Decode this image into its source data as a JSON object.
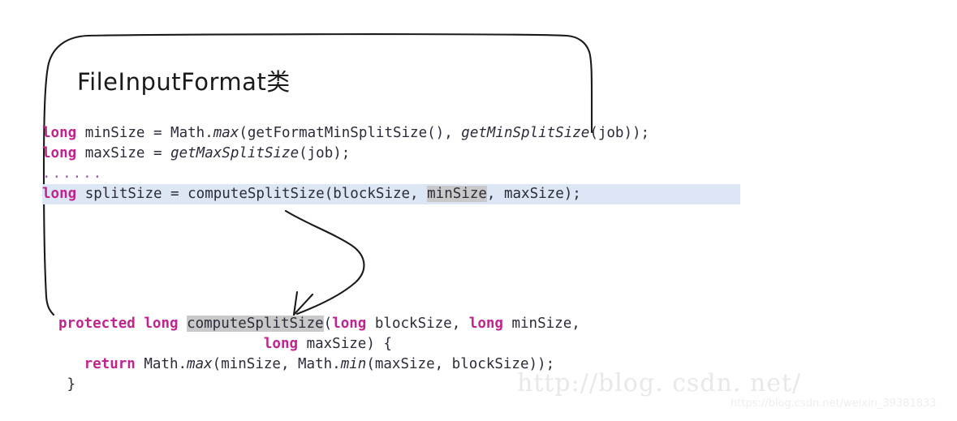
{
  "title": "FileInputFormat类",
  "annotations": {
    "bracket_label": "hand-drawn-bracket",
    "arrow_label": "curved-arrow-to-method-definition"
  },
  "code_top": {
    "lines": [
      {
        "id": "line-minsize",
        "selected": false,
        "tokens": [
          {
            "text": "long",
            "style": "kw"
          },
          {
            "text": " minSize = Math.",
            "style": "plain"
          },
          {
            "text": "max",
            "style": "italic"
          },
          {
            "text": "(getFormatMinSplitSize(), ",
            "style": "plain"
          },
          {
            "text": "getMinSplitSize",
            "style": "italic"
          },
          {
            "text": "(job));",
            "style": "plain"
          }
        ]
      },
      {
        "id": "line-maxsize",
        "selected": false,
        "tokens": [
          {
            "text": "long",
            "style": "kw"
          },
          {
            "text": " maxSize = ",
            "style": "plain"
          },
          {
            "text": "getMaxSplitSize",
            "style": "italic"
          },
          {
            "text": "(job);",
            "style": "plain"
          }
        ]
      },
      {
        "id": "line-ellipsis",
        "selected": false,
        "tokens": [
          {
            "text": "......",
            "style": "ellipsis"
          }
        ]
      },
      {
        "id": "line-splitsize",
        "selected": true,
        "tokens": [
          {
            "text": "long",
            "style": "kw"
          },
          {
            "text": " splitSize = computeSplitSize(blockSize, ",
            "style": "plain"
          },
          {
            "text": "minSize",
            "style": "hl"
          },
          {
            "text": ", maxSize);",
            "style": "plain"
          }
        ]
      }
    ]
  },
  "code_bottom": {
    "lines": [
      {
        "id": "line-method-signature",
        "selected": false,
        "tokens": [
          {
            "text": "protected",
            "style": "kw"
          },
          {
            "text": " ",
            "style": "plain"
          },
          {
            "text": "long",
            "style": "kw"
          },
          {
            "text": " ",
            "style": "plain"
          },
          {
            "text": "computeSplitSize",
            "style": "hl"
          },
          {
            "text": "(",
            "style": "plain"
          },
          {
            "text": "long",
            "style": "kw"
          },
          {
            "text": " blockSize, ",
            "style": "plain"
          },
          {
            "text": "long",
            "style": "kw"
          },
          {
            "text": " minSize,",
            "style": "plain"
          }
        ]
      },
      {
        "id": "line-method-signature-cont",
        "selected": false,
        "tokens": [
          {
            "text": "                        ",
            "style": "plain"
          },
          {
            "text": "long",
            "style": "kw"
          },
          {
            "text": " maxSize) {",
            "style": "plain"
          }
        ]
      },
      {
        "id": "line-return",
        "selected": false,
        "tokens": [
          {
            "text": "   ",
            "style": "plain"
          },
          {
            "text": "return",
            "style": "kw"
          },
          {
            "text": " Math.",
            "style": "plain"
          },
          {
            "text": "max",
            "style": "italic"
          },
          {
            "text": "(minSize, Math.",
            "style": "plain"
          },
          {
            "text": "min",
            "style": "italic"
          },
          {
            "text": "(maxSize, blockSize));",
            "style": "plain"
          }
        ]
      },
      {
        "id": "line-close-brace",
        "selected": false,
        "tokens": [
          {
            "text": " }",
            "style": "plain"
          }
        ]
      }
    ]
  },
  "watermark": {
    "big": "http://blog. csdn. net/",
    "small": "https://blog.csdn.net/weixin_39381833"
  },
  "colors": {
    "keyword": "#c1248e",
    "text": "#2b2b3a",
    "selection": "#dce6f5",
    "highlight": "#c9c9c9",
    "ink": "#1a1a1a",
    "watermark": "#e8e8e8"
  }
}
